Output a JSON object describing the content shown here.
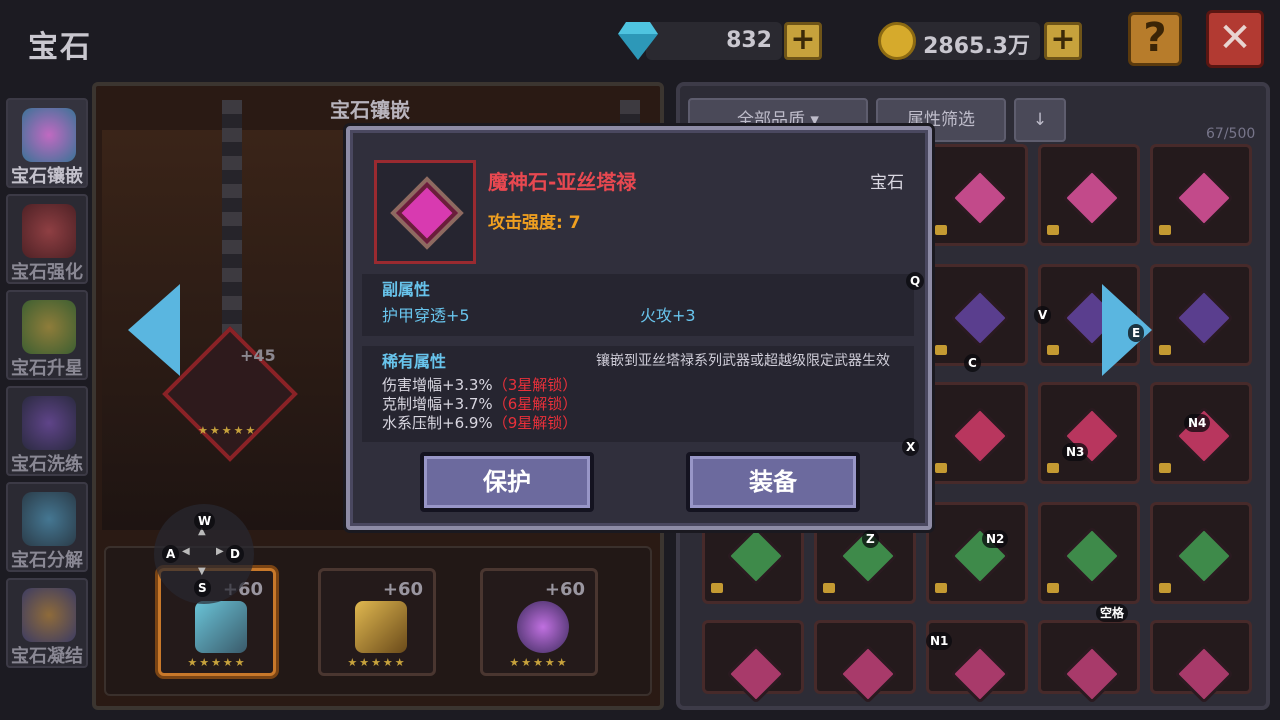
{
  "header": {
    "title": "宝石",
    "diamonds": "832",
    "gold": "2865.3万"
  },
  "sidebar": {
    "items": [
      {
        "label": "宝石镶嵌",
        "icon": "gem-socket-icon",
        "active": true
      },
      {
        "label": "宝石强化",
        "icon": "heart-gem-icon",
        "active": false
      },
      {
        "label": "宝石升星",
        "icon": "star-icon",
        "active": false
      },
      {
        "label": "宝石洗练",
        "icon": "purple-gem-icon",
        "active": false
      },
      {
        "label": "宝石分解",
        "icon": "scroll-icon",
        "active": false
      },
      {
        "label": "宝石凝结",
        "icon": "crystal-icon",
        "active": false
      }
    ]
  },
  "socket": {
    "title": "宝石镶嵌",
    "socket_plus": "+45",
    "stars": "★★★★★",
    "equip": [
      {
        "plus": "+60",
        "stars": "★★★★★",
        "icon": "staff-icon",
        "selected": true
      },
      {
        "plus": "+60",
        "stars": "★★★★★",
        "icon": "crown-icon",
        "selected": false
      },
      {
        "plus": "+60",
        "stars": "★★★★★",
        "icon": "orb-icon",
        "selected": false
      }
    ]
  },
  "inventory": {
    "quality_filter": "全部品质",
    "attr_filter": "属性筛选",
    "count": "67/500",
    "gem_colors": [
      "#c24a8a",
      "#5a3e8e",
      "#b8365e",
      "#3e8a4a",
      "#a83a6a"
    ]
  },
  "dialog": {
    "gem_name": "魔神石-亚丝塔禄",
    "gem_type": "宝石",
    "attack": "攻击强度: 7",
    "sub_attr_title": "副属性",
    "sub_attr_1": "护甲穿透+5",
    "sub_attr_2": "火攻+3",
    "rare_title": "稀有属性",
    "rare_note": "镶嵌到亚丝塔禄系列武器或超越级限定武器生效",
    "rare_lines": [
      {
        "text": "伤害增幅+3.3%",
        "lock": "（3星解锁）"
      },
      {
        "text": "克制增幅+3.7%",
        "lock": "（6星解锁）"
      },
      {
        "text": "水系压制+6.9%",
        "lock": "（9星解锁）"
      }
    ],
    "protect_label": "保护",
    "equip_label": "装备"
  },
  "key_hints": {
    "q": "Q",
    "x": "X",
    "e": "E",
    "v": "V",
    "c": "C",
    "z": "Z",
    "n1": "N1",
    "n2": "N2",
    "n3": "N3",
    "n4": "N4",
    "space": "空格",
    "w": "W",
    "a": "A",
    "s": "S",
    "d": "D"
  },
  "colors": {
    "accent_blue": "#5ab6e0",
    "gold": "#c7a23c",
    "rare_red": "#e8303a",
    "name_red": "#e84850",
    "attack_orange": "#f0a020"
  }
}
